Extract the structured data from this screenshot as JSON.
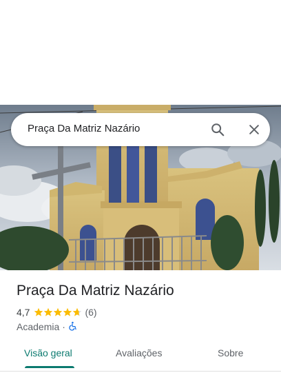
{
  "search": {
    "query": "Praça Da Matriz Nazário",
    "search_icon": "search-icon",
    "close_icon": "close-icon"
  },
  "place": {
    "name": "Praça Da Matriz Nazário",
    "rating": "4,7",
    "stars": 4.7,
    "review_count": "(6)",
    "category": "Academia",
    "separator": "·",
    "accessibility_icon": "wheelchair-icon"
  },
  "tabs": [
    {
      "label": "Visão geral",
      "active": true
    },
    {
      "label": "Avaliações",
      "active": false
    },
    {
      "label": "Sobre",
      "active": false
    }
  ],
  "colors": {
    "accent": "#0b7a6f",
    "star": "#fbbc04",
    "accessibility": "#1a73e8"
  }
}
